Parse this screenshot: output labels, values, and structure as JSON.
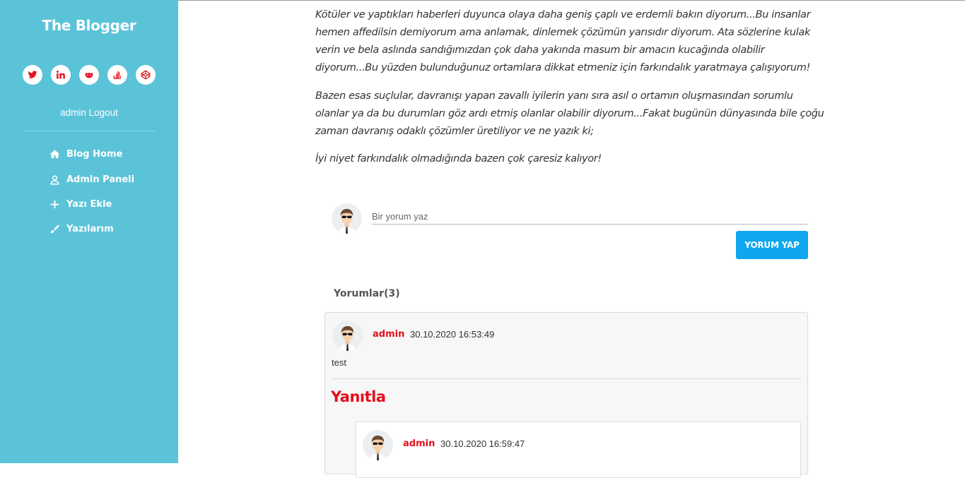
{
  "sidebar": {
    "brand": "The Blogger",
    "social": [
      {
        "icon": "twitter-icon"
      },
      {
        "icon": "linkedin-icon"
      },
      {
        "icon": "github-icon"
      },
      {
        "icon": "stackoverflow-icon"
      },
      {
        "icon": "codepen-icon"
      }
    ],
    "user_name": "admin",
    "logout_label": "Logout",
    "nav": [
      {
        "label": "Blog Home",
        "icon": "home-icon"
      },
      {
        "label": "Admin Paneli",
        "icon": "user-icon"
      },
      {
        "label": "Yazı Ekle",
        "icon": "plus-icon"
      },
      {
        "label": "Yazılarım",
        "icon": "pen-icon"
      }
    ]
  },
  "article": {
    "paragraphs": [
      "Kötüler ve yaptıkları haberleri duyunca olaya daha geniş çaplı ve erdemli bakın diyorum...Bu insanlar hemen affedilsin demiyorum ama anlamak, dinlemek çözümün yarısıdır diyorum. Ata sözlerine kulak verin ve bela aslında sandığımızdan çok daha yakında masum bir amacın kucağında olabilir diyorum...Bu yüzden bulunduğunuz ortamlara dikkat etmeniz için farkındalık yaratmaya çalışıyorum!",
      "Bazen esas suçlular, davranışı yapan zavallı iyilerin yanı sıra asıl o ortamın oluşmasından sorumlu olanlar ya da bu durumları göz ardı etmiş olanlar olabilir diyorum...Fakat bugünün dünyasında bile çoğu zaman davranış odaklı çözümler üretiliyor ve ne yazık ki;",
      "İyi niyet farkındalık olmadığında bazen çok çaresiz kalıyor!"
    ]
  },
  "comment_form": {
    "placeholder": "Bir yorum yaz",
    "submit_label": "YORUM YAP"
  },
  "comments": {
    "title": "Yorumlar(3)",
    "items": [
      {
        "author": "admin",
        "date": "30.10.2020 16:53:49",
        "text": "test",
        "reply_label": "Yanıtla",
        "replies": [
          {
            "author": "admin",
            "date": "30.10.2020 16:59:47"
          }
        ]
      }
    ]
  },
  "colors": {
    "sidebar_bg": "#5bc3d8",
    "accent_red": "#e4101c",
    "button_blue": "#0fa6ef"
  }
}
